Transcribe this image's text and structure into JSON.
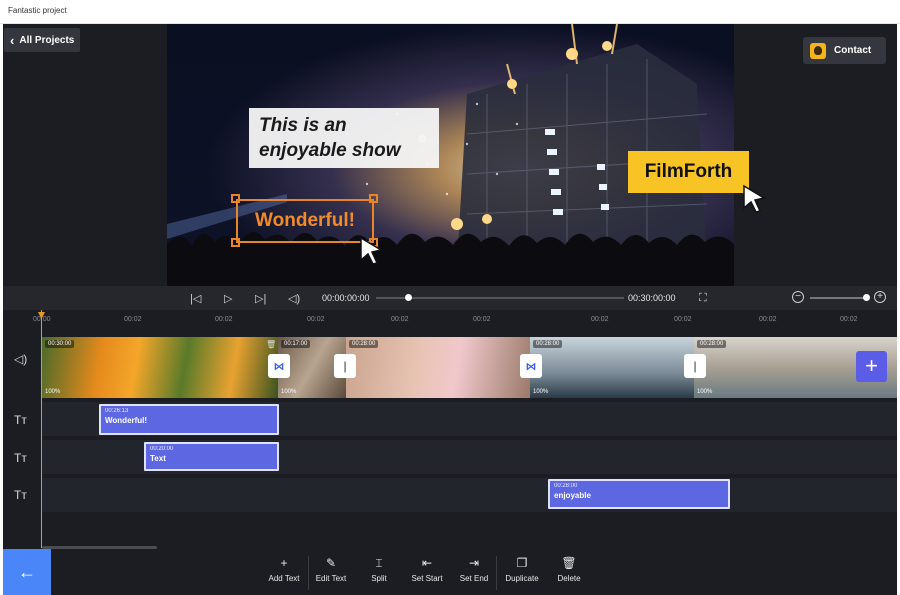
{
  "window": {
    "title": "Fantastic project"
  },
  "header": {
    "back_label": "All Projects",
    "contact_label": "Contact"
  },
  "preview": {
    "caption_lines": [
      "This is an",
      "enjoyable show"
    ],
    "selected_text": "Wonderful!",
    "brand_text": "FilmForth"
  },
  "playback": {
    "current_time": "00:00:00:00",
    "total_time": "00:30:00:00"
  },
  "ruler": {
    "ticks": [
      "00:00",
      "00:02",
      "00:02",
      "00:02",
      "00:02",
      "00:02",
      "00:02",
      "00:02",
      "00:02",
      "00:02"
    ]
  },
  "video_track": {
    "clips": [
      {
        "duration": "00:30:00",
        "volume": "100%"
      },
      {
        "duration": "00:17:00",
        "volume": "100%"
      },
      {
        "duration": "00:28:00",
        "volume": ""
      },
      {
        "duration": "00:28:00",
        "volume": "100%"
      },
      {
        "duration": "00:28:00",
        "volume": "100%"
      }
    ]
  },
  "text_tracks": [
    {
      "duration": "00:26:13",
      "name": "Wonderful!"
    },
    {
      "duration": "00:20:00",
      "name": "Text"
    },
    {
      "duration": "00:28:00",
      "name": "enjoyable"
    }
  ],
  "toolbar": {
    "add_text": "Add Text",
    "edit_text": "Edit Text",
    "split": "Split",
    "set_start": "Set Start",
    "set_end": "Set End",
    "duplicate": "Duplicate",
    "delete": "Delete"
  },
  "colors": {
    "accent": "#5d67e1",
    "playhead": "#e59a28",
    "brand": "#f7c325",
    "back_button": "#4a86f7"
  }
}
